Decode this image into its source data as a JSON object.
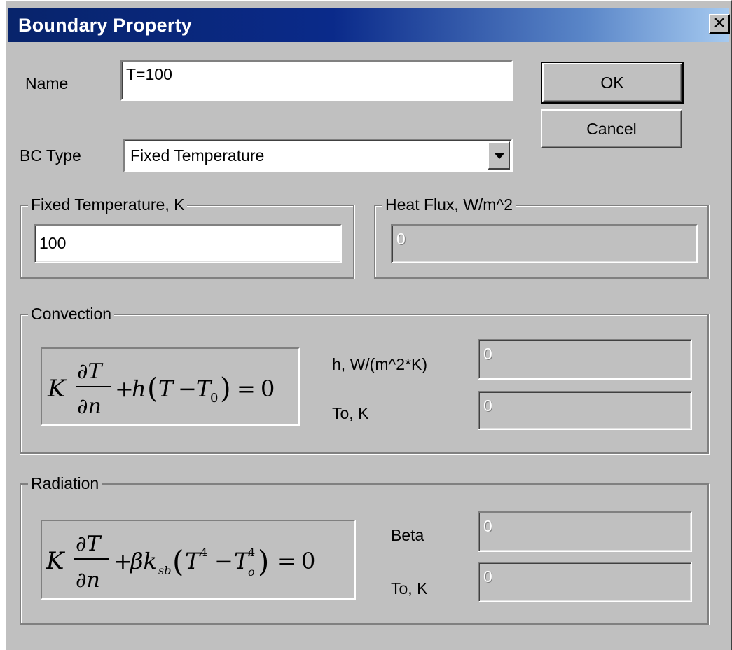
{
  "window": {
    "title": "Boundary Property",
    "close_label": "×"
  },
  "name": {
    "label": "Name",
    "value": "T=100"
  },
  "buttons": {
    "ok": "OK",
    "cancel": "Cancel"
  },
  "bc_type": {
    "label": "BC Type",
    "selected": "Fixed Temperature"
  },
  "fixed_temperature": {
    "legend": "Fixed Temperature, K",
    "value": "100"
  },
  "heat_flux": {
    "legend": "Heat Flux, W/m^2",
    "value": "0"
  },
  "convection": {
    "legend": "Convection",
    "equation": "K ∂T/∂n + h(T − T₀) = 0",
    "h_label": "h, W/(m^2*K)",
    "h_value": "0",
    "to_label": "To, K",
    "to_value": "0"
  },
  "radiation": {
    "legend": "Radiation",
    "equation": "K ∂T/∂n + βk_sb(T⁴ − T_o⁴) = 0",
    "beta_label": "Beta",
    "beta_value": "0",
    "to_label": "To, K",
    "to_value": "0"
  },
  "colors": {
    "dialog_bg": "#c0c0c0",
    "titlebar_start": "#08246b",
    "titlebar_end": "#a6caf0",
    "title_text": "#ffffff"
  }
}
